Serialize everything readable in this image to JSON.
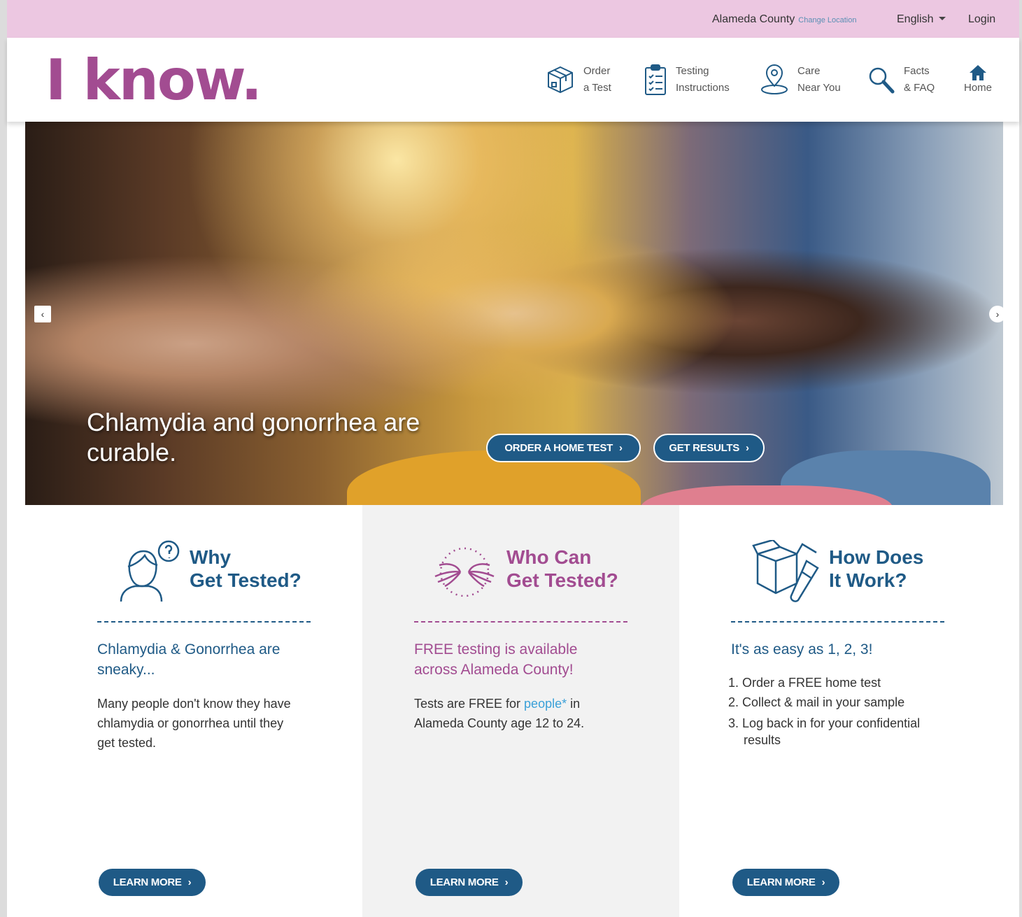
{
  "topbar": {
    "location": "Alameda County",
    "change_location": "Change Location",
    "language": "English",
    "login": "Login"
  },
  "header": {
    "logo": "I know.",
    "nav": [
      {
        "line1": "Order",
        "line2": "a Test",
        "icon": "package-icon"
      },
      {
        "line1": "Testing",
        "line2": "Instructions",
        "icon": "clipboard-icon"
      },
      {
        "line1": "Care",
        "line2": "Near You",
        "icon": "map-pin-icon"
      },
      {
        "line1": "Facts",
        "line2": "& FAQ",
        "icon": "magnifier-icon"
      },
      {
        "line1": "Home",
        "line2": "",
        "icon": "home-icon"
      }
    ]
  },
  "hero": {
    "headline": "Chlamydia and gonorrhea are curable.",
    "order_button": "ORDER A HOME TEST",
    "results_button": "GET RESULTS",
    "prev": "‹",
    "next": "›"
  },
  "columns": {
    "why": {
      "title_line1": "Why",
      "title_line2": "Get Tested?",
      "subhead": "Chlamydia & Gonorrhea are sneaky...",
      "body": "Many people don't know they have chlamydia or gonorrhea until they get tested.",
      "button": "LEARN MORE"
    },
    "who": {
      "title_line1": "Who Can",
      "title_line2": "Get Tested?",
      "subhead": "FREE testing is available across Alameda County!",
      "body_before": "Tests are FREE for ",
      "body_link": "people*",
      "body_after": " in Alameda County age 12 to 24.",
      "button": "LEARN MORE"
    },
    "how": {
      "title_line1": "How Does",
      "title_line2": "It Work?",
      "subhead": "It's as easy as 1, 2, 3!",
      "steps": [
        "1. Order a FREE home test",
        "2. Collect & mail in your sample",
        "3. Log back in for your confidential results"
      ],
      "button": "LEARN MORE"
    }
  },
  "colors": {
    "brand_purple": "#a24c91",
    "brand_blue": "#1f5a86",
    "topbar_pink": "#ecc7e1",
    "link_blue": "#3aa0d8"
  }
}
